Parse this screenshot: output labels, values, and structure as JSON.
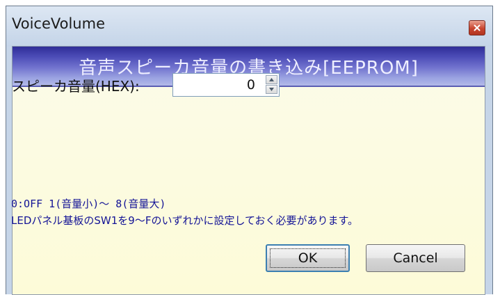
{
  "window": {
    "title": "VoiceVolume",
    "close_icon": "close-icon"
  },
  "header": {
    "title": "音声スピーカ音量の書き込み[EEPROM]"
  },
  "form": {
    "volume_label": "スピーカ音量(HEX):",
    "volume_value": "0"
  },
  "notes": {
    "line1": "0:OFF 1(音量小)～ 8(音量大)",
    "line2": "LEDパネル基板のSW1を9～Fのいずれかに設定しておく必要があります。"
  },
  "buttons": {
    "ok_label": "OK",
    "cancel_label": "Cancel"
  },
  "colors": {
    "header_gradient_dark": "#2f2d97",
    "header_gradient_light": "#b3bae8",
    "client_background": "#fdfbd8",
    "note_text": "#141496",
    "close_button": "#c8452f"
  }
}
